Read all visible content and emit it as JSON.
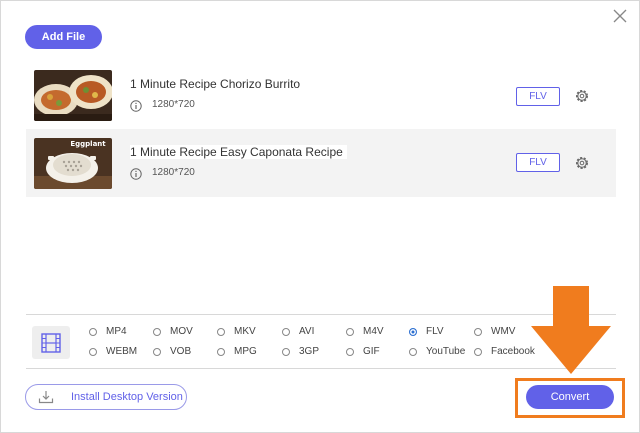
{
  "header": {
    "add_file_label": "Add File"
  },
  "files": [
    {
      "name": "1 Minute Recipe Chorizo Burrito",
      "resolution": "1280*720",
      "format": "FLV"
    },
    {
      "name": "1 Minute Recipe Easy Caponata Recipe",
      "resolution": "1280*720",
      "format": "FLV",
      "thumb_text": "Eggplant"
    }
  ],
  "formats": {
    "row1": [
      "MP4",
      "MOV",
      "MKV",
      "AVI",
      "M4V",
      "FLV",
      "WMV"
    ],
    "row2": [
      "WEBM",
      "VOB",
      "MPG",
      "3GP",
      "GIF",
      "YouTube",
      "Facebook"
    ],
    "selected": "FLV"
  },
  "footer": {
    "install_label": "Install Desktop Version",
    "convert_label": "Convert"
  },
  "colors": {
    "accent": "#6161e8",
    "highlight": "#f07c1e",
    "radio_selected": "#2c6fd1"
  }
}
